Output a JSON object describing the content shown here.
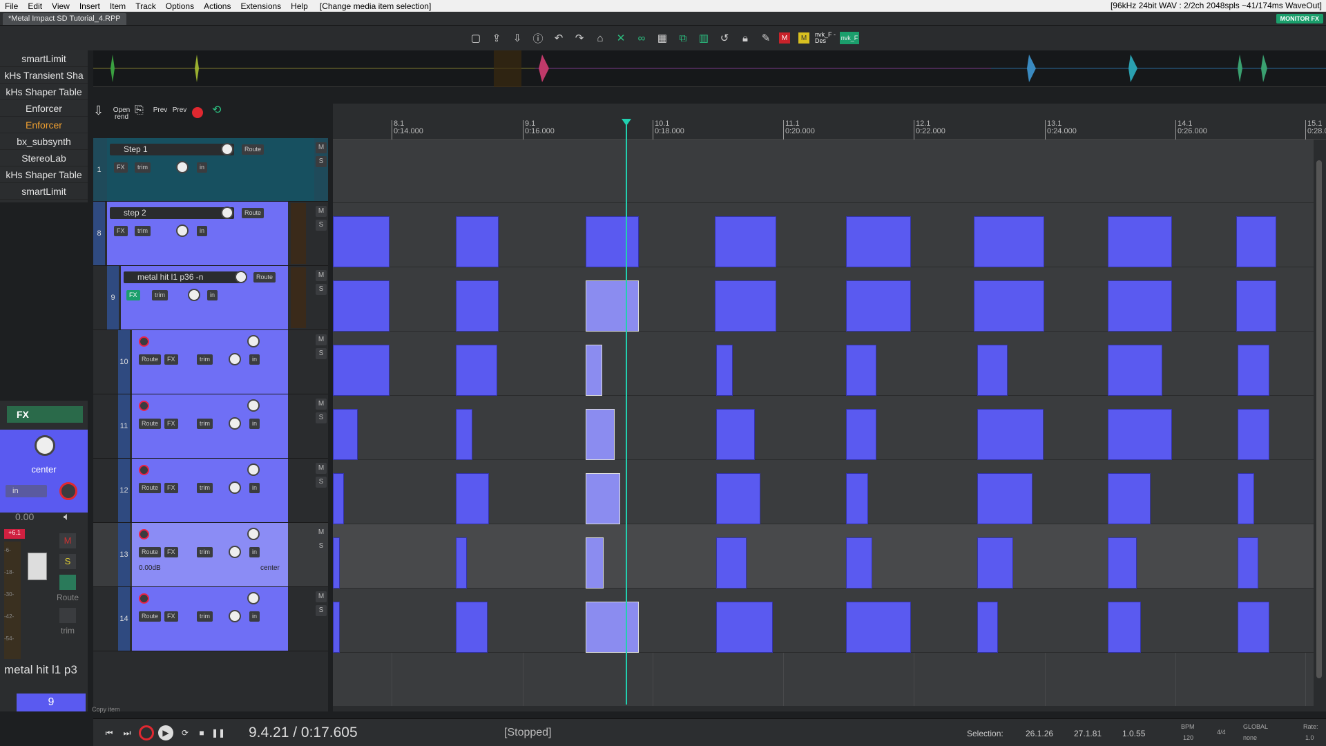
{
  "menu": {
    "items": [
      "File",
      "Edit",
      "View",
      "Insert",
      "Item",
      "Track",
      "Options",
      "Actions",
      "Extensions",
      "Help"
    ],
    "hint": "[Change media item selection]",
    "audio_status": "[96kHz 24bit WAV : 2/2ch 2048spls ~41/174ms WaveOut]"
  },
  "project_tab": "*Metal Impact SD Tutorial_4.RPP",
  "monitor_fx": "MONITOR FX",
  "toolbar_icons": [
    "new-icon",
    "open-icon",
    "save-icon",
    "info-icon",
    "undo-icon",
    "redo-icon",
    "metronome-icon",
    "snap-icon",
    "link-icon",
    "grid-icon",
    "grouping-icon",
    "grid-lines-icon",
    "loop-icon",
    "lock-icon",
    "envelope-icon",
    "m-icon",
    "m2-icon"
  ],
  "toolbar_labels": {
    "nvk1": "nvk_F -Des",
    "nvk2": "nvk_F"
  },
  "fx_list": [
    "smartLimit",
    "kHs Transient Sha",
    "kHs Shaper Table",
    "Enforcer",
    "Enforcer",
    "bx_subsynth",
    "StereoLab",
    "kHs Shaper Table",
    "smartLimit"
  ],
  "tcp_toolbar": {
    "open_rend": "Open rend",
    "prev1": "Prev",
    "prev2": "Prev"
  },
  "ruler": {
    "marks": [
      {
        "bar": "8.1",
        "time": "0:14.000"
      },
      {
        "bar": "9.1",
        "time": "0:16.000"
      },
      {
        "bar": "10.1",
        "time": "0:18.000"
      },
      {
        "bar": "11.1",
        "time": "0:20.000"
      },
      {
        "bar": "12.1",
        "time": "0:22.000"
      },
      {
        "bar": "13.1",
        "time": "0:24.000"
      },
      {
        "bar": "14.1",
        "time": "0:26.000"
      },
      {
        "bar": "15.1",
        "time": "0:28.0"
      }
    ]
  },
  "tracks": [
    {
      "num": "1",
      "name": "Step 1",
      "label": "Route"
    },
    {
      "num": "8",
      "name": "step 2",
      "label": "Route"
    },
    {
      "num": "9",
      "name": "metal hit l1 p36 -n",
      "label": "Route"
    },
    {
      "num": "10",
      "name": "",
      "label": "Route"
    },
    {
      "num": "11",
      "name": "",
      "label": "Route"
    },
    {
      "num": "12",
      "name": "",
      "label": "Route"
    },
    {
      "num": "13",
      "name": "",
      "label": "Route",
      "vol": "0.00dB",
      "pan": "center"
    },
    {
      "num": "14",
      "name": "",
      "label": "Route"
    }
  ],
  "track_btns": {
    "fx": "FX",
    "trim": "trim",
    "in": "in",
    "m": "M",
    "s": "S"
  },
  "mixer": {
    "fx": "FX",
    "pan": "center",
    "in": "in",
    "vol": "0.00",
    "peak": "+6.1",
    "scale": [
      "-6-",
      "-18-",
      "-30-",
      "-42-",
      "-54-"
    ],
    "m": "M",
    "s": "S",
    "route": "Route",
    "trim": "trim",
    "track_name": "metal hit l1 p3",
    "track_num": "9"
  },
  "status_left": "Copy item",
  "transport": {
    "position": "9.4.21 / 0:17.605",
    "state": "[Stopped]",
    "selection_label": "Selection:",
    "sel_start": "26.1.26",
    "sel_end": "27.1.81",
    "sel_len": "1.0.55",
    "bpm_label": "BPM",
    "bpm": "120",
    "sig": "4/4",
    "global": "GLOBAL",
    "none": "none",
    "rate_label": "Rate:",
    "rate": "1.0"
  },
  "colors": {
    "item": "#5a5af0",
    "item_selected": "#8b8cf0",
    "cursor": "#21d0b0",
    "track_panel": "#6f6ff5"
  }
}
